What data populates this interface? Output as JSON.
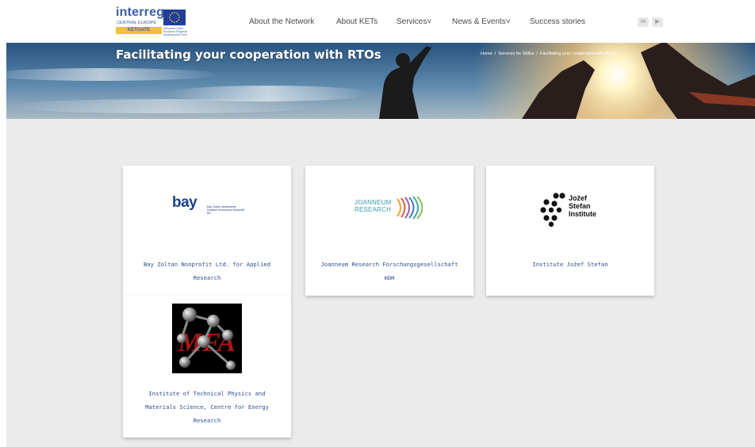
{
  "header": {
    "logo": {
      "brand": "interreg",
      "program": "CENTRAL EUROPE",
      "project": "KETGATE",
      "eu_text": "European Union European Regional Development Fund"
    },
    "nav": [
      {
        "label": "About the Network"
      },
      {
        "label": "About KETs"
      },
      {
        "label": "Services",
        "caret": "˅"
      },
      {
        "label": "News & Events",
        "caret": "˅"
      },
      {
        "label": "Success stories"
      }
    ],
    "social": [
      {
        "label": "in",
        "icon": "linkedin-icon"
      },
      {
        "label": "▶",
        "icon": "youtube-icon"
      }
    ]
  },
  "hero": {
    "title": "Facilitating your cooperation with RTOs",
    "breadcrumb": [
      "Home",
      "Services for SMEs",
      "Facilitating your cooperation with RTOs"
    ]
  },
  "cards": [
    {
      "title": "Bay Zoltan Nonprofit Ltd. for Applied Research",
      "logo_text": "bay",
      "logo_sub": "Bay Zoltán Alkalmazott Kutatási Közhasznú Nonprofit Kft."
    },
    {
      "title": "Joanneum Research Forschungsgesellschaft mbH",
      "logo_text": "JOANNEUM RESEARCH"
    },
    {
      "title": "Institute Jožef Stefan",
      "logo_text": [
        "Jožef",
        "Stefan",
        "Institute"
      ]
    },
    {
      "title": "Institute of Technical Physics and Materials Science, Centre for Energy Research",
      "logo_text": "MFA"
    }
  ],
  "colors": {
    "nav_text": "#4a4a4a",
    "card_text": "#2a4d8f",
    "content_bg": "#ebebeb",
    "brand_blue": "#3d5fa8",
    "brand_yellow": "#f2c230"
  }
}
